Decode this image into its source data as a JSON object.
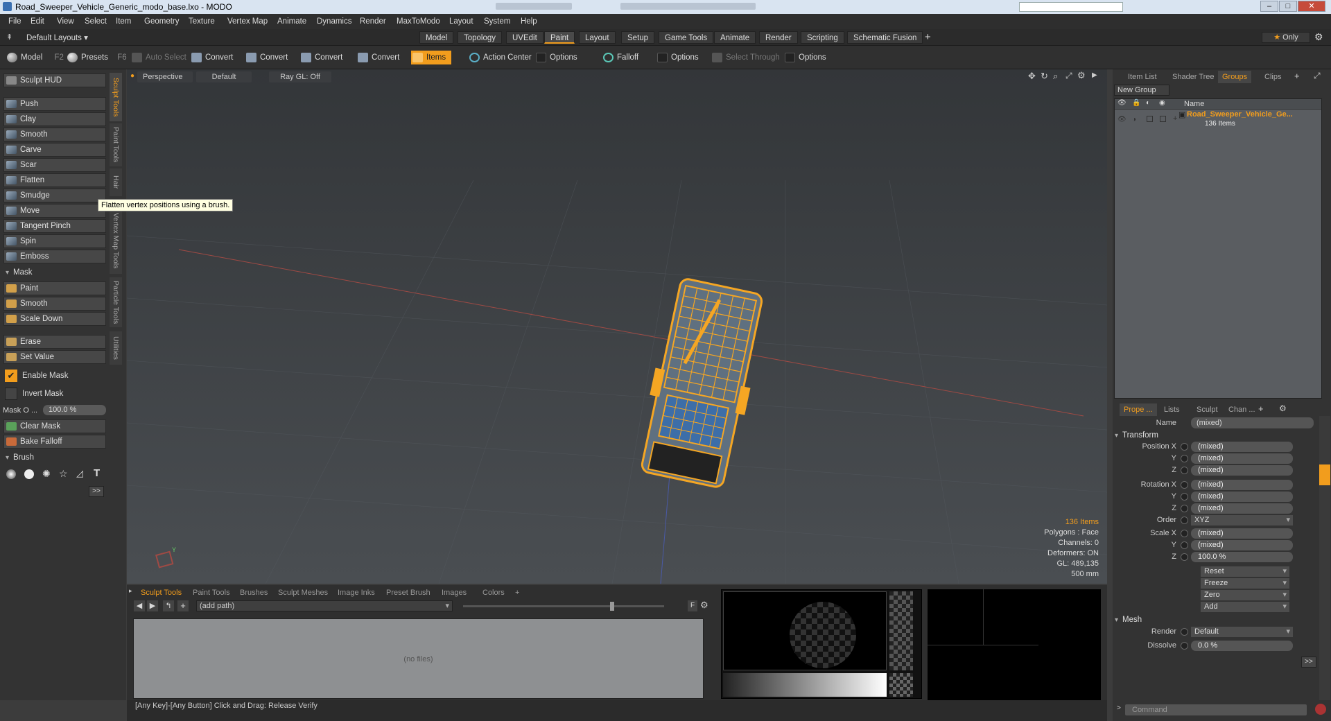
{
  "window": {
    "title": "Road_Sweeper_Vehicle_Generic_modo_base.lxo - MODO"
  },
  "menubar": [
    "File",
    "Edit",
    "View",
    "Select",
    "Item",
    "Geometry",
    "Texture",
    "Vertex Map",
    "Animate",
    "Dynamics",
    "Render",
    "MaxToModo",
    "Layout",
    "System",
    "Help"
  ],
  "layoutbar": {
    "layout_name": "Default Layouts",
    "tabs": [
      "Model",
      "Topology",
      "UVEdit",
      "Paint",
      "Layout",
      "Setup",
      "Game Tools",
      "Animate",
      "Render",
      "Scripting",
      "Schematic Fusion"
    ],
    "active_tab": "Paint",
    "only_label": "Only"
  },
  "toolbar": {
    "model": "Model",
    "model_key": "F2",
    "presets": "Presets",
    "presets_key": "F6",
    "auto_select": "Auto Select",
    "convert1": "Convert",
    "convert2": "Convert",
    "convert3": "Convert",
    "convert4": "Convert",
    "items": "Items",
    "action_center": "Action Center",
    "options1": "Options",
    "falloff": "Falloff",
    "options2": "Options",
    "select_through": "Select Through",
    "options3": "Options"
  },
  "sculpt_panel": {
    "hud": "Sculpt HUD",
    "tools": [
      "Push",
      "Clay",
      "Smooth",
      "Carve",
      "Scar",
      "Flatten",
      "Smudge",
      "Move",
      "Tangent Pinch",
      "Spin",
      "Emboss"
    ],
    "mask_section": "Mask",
    "mask_tools": [
      "Paint",
      "Smooth",
      "Scale Down"
    ],
    "erase": "Erase",
    "set_value": "Set Value",
    "enable_mask": "Enable Mask",
    "invert_mask": "Invert Mask",
    "mask_opacity_label": "Mask O ...",
    "mask_opacity_value": "100.0 %",
    "clear_mask": "Clear Mask",
    "bake_falloff": "Bake Falloff",
    "brush_section": "Brush",
    "more": ">>",
    "vertical_tabs": [
      "Sculpt Tools",
      "Paint Tools",
      "Hair Tools",
      "Vertex Map Tools",
      "Particle Tools",
      "Utilities"
    ],
    "tooltip": "Flatten vertex positions using a brush."
  },
  "viewport": {
    "view": "Perspective",
    "shading": "Default",
    "raygl": "Ray GL: Off",
    "info": {
      "items": "136 Items",
      "polygons": "Polygons : Face",
      "channels": "Channels: 0",
      "deformers": "Deformers: ON",
      "gl": "GL: 489,135",
      "size": "500 mm"
    }
  },
  "bottom": {
    "tabs": [
      "Sculpt Tools",
      "Paint Tools",
      "Brushes",
      "Sculpt Meshes",
      "Image Inks",
      "Preset Brush",
      "Images",
      "Colors"
    ],
    "path": "(add path)",
    "empty": "(no files)",
    "f_label": "F"
  },
  "statusbar": {
    "text": "[Any Key]-[Any Button] Click and Drag:   Release Verify"
  },
  "right_panel": {
    "top_tabs": [
      "Item List",
      "Shader Tree",
      "Groups",
      "Clips"
    ],
    "active_top": "Groups",
    "new_group": "New Group",
    "name_col": "Name",
    "group_name": "Road_Sweeper_Vehicle_Ge...",
    "group_count": "136 Items",
    "prop_tabs": [
      "Prope ...",
      "Lists",
      "Sculpt",
      "Chan ..."
    ],
    "name_label": "Name",
    "name_value": "(mixed)",
    "transform": "Transform",
    "position": {
      "label": "Position X",
      "x": "(mixed)",
      "y": "(mixed)",
      "z": "(mixed)"
    },
    "rotation": {
      "label": "Rotation X",
      "x": "(mixed)",
      "y": "(mixed)",
      "z": "(mixed)"
    },
    "order_label": "Order",
    "order_value": "XYZ",
    "scale": {
      "label": "Scale X",
      "x": "(mixed)",
      "y": "(mixed)",
      "z": "100.0 %"
    },
    "axis_y": "Y",
    "axis_z": "Z",
    "actions": [
      "Reset",
      "Freeze",
      "Zero",
      "Add"
    ],
    "mesh": "Mesh",
    "render_label": "Render",
    "render_value": "Default",
    "dissolve_label": "Dissolve",
    "dissolve_value": "0.0 %",
    "more": ">>",
    "command": "Command"
  },
  "colors": {
    "accent": "#f29d1d",
    "wire": "#f5a623",
    "panel": "#333333"
  }
}
